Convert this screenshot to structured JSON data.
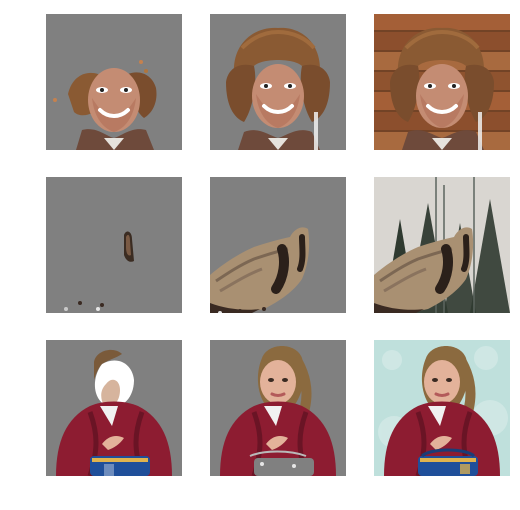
{
  "grid": {
    "rows": 3,
    "cols": 3,
    "masked_background": "#808080",
    "tiles": [
      [
        {
          "subject": "man-in-fur-hat",
          "variant": "partial-mask"
        },
        {
          "subject": "man-in-fur-hat",
          "variant": "full-mask"
        },
        {
          "subject": "man-in-fur-hat",
          "variant": "original"
        }
      ],
      [
        {
          "subject": "coat-in-forest",
          "variant": "partial-mask"
        },
        {
          "subject": "coat-in-forest",
          "variant": "full-mask"
        },
        {
          "subject": "coat-in-forest",
          "variant": "original"
        }
      ],
      [
        {
          "subject": "woman-in-red-jacket",
          "variant": "partial-mask"
        },
        {
          "subject": "woman-in-red-jacket",
          "variant": "full-mask"
        },
        {
          "subject": "woman-in-red-jacket",
          "variant": "original"
        }
      ]
    ]
  }
}
